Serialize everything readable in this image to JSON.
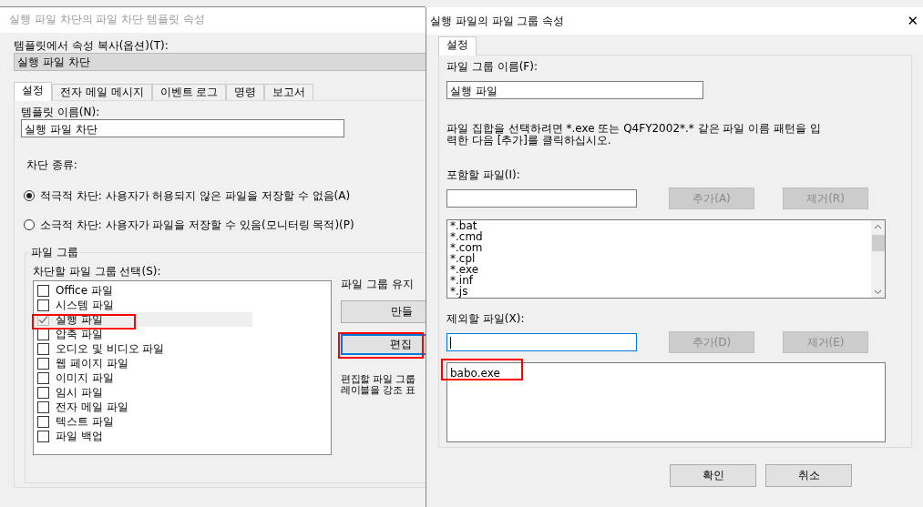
{
  "template_dialog": {
    "title": "실행 파일 차단의 파일 차단 템플릿 속성",
    "copy_label": "템플릿에서 속성 복사(옵션)(T):",
    "copy_value": "실행 파일 차단",
    "tabs": [
      {
        "label": "설정",
        "selected": true
      },
      {
        "label": "전자 메일 메시지",
        "selected": false
      },
      {
        "label": "이벤트 로그",
        "selected": false
      },
      {
        "label": "명령",
        "selected": false
      },
      {
        "label": "보고서",
        "selected": false
      }
    ],
    "name_label": "템플릿 이름(N):",
    "name_value": "실행 파일 차단",
    "screening_label": "차단 종류:",
    "screening_options": [
      {
        "label": "적극적 차단: 사용자가 허용되지 않은 파일을 저장할 수 없음(A)",
        "selected": true
      },
      {
        "label": "소극적 차단: 사용자가 파일을 저장할 수 있음(모니터링 목적)(P)",
        "selected": false
      }
    ],
    "group_box_title": "파일 그룹",
    "select_label": "차단할 파일 그룹 선택(S):",
    "file_groups": [
      {
        "label": "Office 파일",
        "checked": false,
        "selected": false
      },
      {
        "label": "시스템 파일",
        "checked": false,
        "selected": false
      },
      {
        "label": "실행 파일",
        "checked": true,
        "selected": true
      },
      {
        "label": "압축 파일",
        "checked": false,
        "selected": false
      },
      {
        "label": "오디오 및 비디오 파일",
        "checked": false,
        "selected": false
      },
      {
        "label": "웹 페이지 파일",
        "checked": false,
        "selected": false
      },
      {
        "label": "이미지 파일",
        "checked": false,
        "selected": false
      },
      {
        "label": "임시 파일",
        "checked": false,
        "selected": false
      },
      {
        "label": "전자 메일 파일",
        "checked": false,
        "selected": false
      },
      {
        "label": "텍스트 파일",
        "checked": false,
        "selected": false
      },
      {
        "label": "파일 백업",
        "checked": false,
        "selected": false
      }
    ],
    "maintain_label": "파일 그룹 유지",
    "buttons": [
      {
        "label": "만들",
        "focused": false
      },
      {
        "label": "편집",
        "focused": true
      }
    ],
    "hint_lines": [
      "편집할 파일 그룹",
      "레이블을 강조 표"
    ]
  },
  "group_dialog": {
    "title": "실행 파일의 파일 그룹 속성",
    "close": "✕",
    "tabs": [
      {
        "label": "설정",
        "selected": true
      }
    ],
    "name_label": "파일 그룹 이름(F):",
    "name_value": "실행 파일",
    "description_lines": [
      "파일 집합을 선택하려면 *.exe 또는 Q4FY2002*.* 같은 파일 이름 패턴을 입",
      "력한 다음 [추가]를 클릭하십시오."
    ],
    "include_label": "포함할 파일(I):",
    "include_buttons": [
      {
        "label": "추가(A)",
        "disabled": true
      },
      {
        "label": "제거(R)",
        "disabled": true
      }
    ],
    "include_files": [
      "*.bat",
      "*.cmd",
      "*.com",
      "*.cpl",
      "*.exe",
      "*.inf",
      "*.js"
    ],
    "exclude_label": "제외할 파일(X):",
    "exclude_buttons": [
      {
        "label": "추가(D)",
        "disabled": true
      },
      {
        "label": "제거(E)",
        "disabled": true
      }
    ],
    "exclude_files": [
      "babo.exe"
    ],
    "footer_buttons": [
      "확인",
      "취소"
    ]
  }
}
